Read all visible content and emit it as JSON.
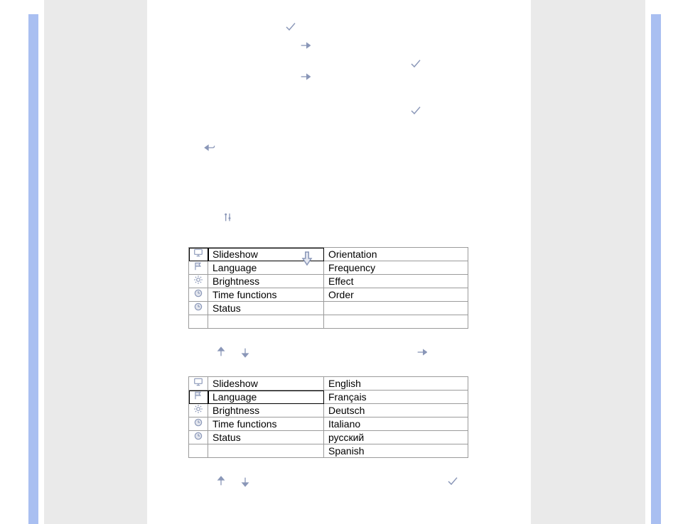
{
  "tables": {
    "slideshow": {
      "rows": [
        {
          "icon": "monitor",
          "label": "Slideshow",
          "sub": "Orientation",
          "sel": true
        },
        {
          "icon": "flag",
          "label": "Language",
          "sub": "Frequency",
          "sel": false
        },
        {
          "icon": "brightness",
          "label": "Brightness",
          "sub": "Effect",
          "sel": false
        },
        {
          "icon": "clock",
          "label": "Time functions",
          "sub": "Order",
          "sel": false
        },
        {
          "icon": "clock",
          "label": "Status",
          "sub": "",
          "sel": false
        },
        {
          "icon": "",
          "label": "",
          "sub": "",
          "sel": false
        }
      ]
    },
    "language": {
      "rows": [
        {
          "icon": "monitor",
          "label": "Slideshow",
          "sub": "English",
          "sel": false
        },
        {
          "icon": "flag",
          "label": "Language",
          "sub": "Français",
          "sel": true
        },
        {
          "icon": "brightness",
          "label": "Brightness",
          "sub": "Deutsch",
          "sel": false
        },
        {
          "icon": "clock",
          "label": "Time functions",
          "sub": "Italiano",
          "sel": false
        },
        {
          "icon": "clock",
          "label": "Status",
          "sub": "русский",
          "sel": false
        },
        {
          "icon": "",
          "label": "",
          "sub": "Spanish",
          "sel": false
        }
      ]
    }
  }
}
